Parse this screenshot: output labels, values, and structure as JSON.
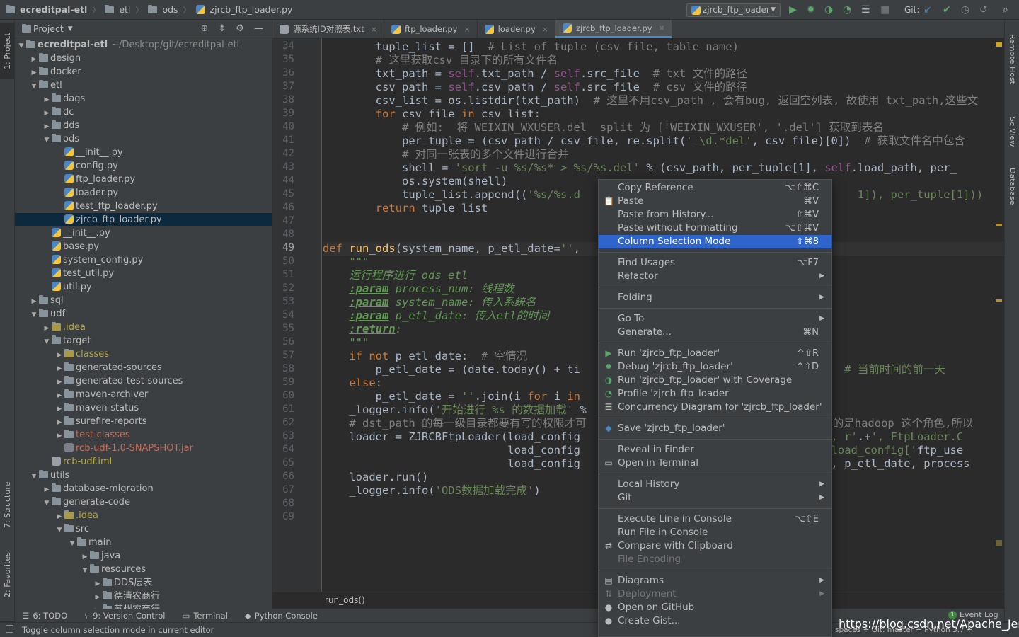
{
  "breadcrumb": [
    "ecreditpal-etl",
    "etl",
    "ods",
    "zjrcb_ftp_loader.py"
  ],
  "run_config": "zjrcb_ftp_loader",
  "git_label": "Git:",
  "project_panel": {
    "title": "Project",
    "root_path": "~/Desktop/git/ecreditpal-etl"
  },
  "tree": [
    {
      "indent": 0,
      "arrow": "open",
      "icon": "folder",
      "label": "ecreditpal-etl",
      "bold": true
    },
    {
      "indent": 1,
      "arrow": "closed",
      "icon": "folder",
      "label": "design"
    },
    {
      "indent": 1,
      "arrow": "closed",
      "icon": "folder",
      "label": "docker"
    },
    {
      "indent": 1,
      "arrow": "open",
      "icon": "folder",
      "label": "etl"
    },
    {
      "indent": 2,
      "arrow": "closed",
      "icon": "folder",
      "label": "dags"
    },
    {
      "indent": 2,
      "arrow": "closed",
      "icon": "folder",
      "label": "dc"
    },
    {
      "indent": 2,
      "arrow": "closed",
      "icon": "folder",
      "label": "dds"
    },
    {
      "indent": 2,
      "arrow": "open",
      "icon": "folder",
      "label": "ods"
    },
    {
      "indent": 3,
      "arrow": "none",
      "icon": "py",
      "label": "__init__.py"
    },
    {
      "indent": 3,
      "arrow": "none",
      "icon": "py",
      "label": "config.py"
    },
    {
      "indent": 3,
      "arrow": "none",
      "icon": "py",
      "label": "ftp_loader.py"
    },
    {
      "indent": 3,
      "arrow": "none",
      "icon": "py",
      "label": "loader.py"
    },
    {
      "indent": 3,
      "arrow": "none",
      "icon": "py",
      "label": "test_ftp_loader.py"
    },
    {
      "indent": 3,
      "arrow": "none",
      "icon": "py",
      "label": "zjrcb_ftp_loader.py",
      "selected": true
    },
    {
      "indent": 2,
      "arrow": "none",
      "icon": "py",
      "label": "__init__.py"
    },
    {
      "indent": 2,
      "arrow": "none",
      "icon": "py",
      "label": "base.py"
    },
    {
      "indent": 2,
      "arrow": "none",
      "icon": "py",
      "label": "system_config.py"
    },
    {
      "indent": 2,
      "arrow": "none",
      "icon": "py",
      "label": "test_util.py"
    },
    {
      "indent": 2,
      "arrow": "none",
      "icon": "py",
      "label": "util.py"
    },
    {
      "indent": 1,
      "arrow": "closed",
      "icon": "folder",
      "label": "sql"
    },
    {
      "indent": 1,
      "arrow": "open",
      "icon": "folder",
      "label": "udf"
    },
    {
      "indent": 2,
      "arrow": "closed",
      "icon": "folder",
      "label": ".idea",
      "color": "yellow"
    },
    {
      "indent": 2,
      "arrow": "open",
      "icon": "folder",
      "label": "target"
    },
    {
      "indent": 3,
      "arrow": "closed",
      "icon": "folder",
      "label": "classes",
      "color": "yellow"
    },
    {
      "indent": 3,
      "arrow": "closed",
      "icon": "folder",
      "label": "generated-sources"
    },
    {
      "indent": 3,
      "arrow": "closed",
      "icon": "folder",
      "label": "generated-test-sources"
    },
    {
      "indent": 3,
      "arrow": "closed",
      "icon": "folder",
      "label": "maven-archiver"
    },
    {
      "indent": 3,
      "arrow": "closed",
      "icon": "folder",
      "label": "maven-status"
    },
    {
      "indent": 3,
      "arrow": "closed",
      "icon": "folder",
      "label": "surefire-reports"
    },
    {
      "indent": 3,
      "arrow": "closed",
      "icon": "folder",
      "label": "test-classes",
      "color": "red"
    },
    {
      "indent": 3,
      "arrow": "none",
      "icon": "jar",
      "label": "rcb-udf-1.0-SNAPSHOT.jar",
      "color": "red"
    },
    {
      "indent": 2,
      "arrow": "none",
      "icon": "iml",
      "label": "rcb-udf.iml",
      "color": "yellow"
    },
    {
      "indent": 1,
      "arrow": "open",
      "icon": "folder",
      "label": "utils"
    },
    {
      "indent": 2,
      "arrow": "closed",
      "icon": "folder",
      "label": "database-migration"
    },
    {
      "indent": 2,
      "arrow": "open",
      "icon": "folder",
      "label": "generate-code"
    },
    {
      "indent": 3,
      "arrow": "closed",
      "icon": "folder",
      "label": ".idea",
      "color": "yellow"
    },
    {
      "indent": 3,
      "arrow": "open",
      "icon": "folder",
      "label": "src"
    },
    {
      "indent": 4,
      "arrow": "open",
      "icon": "folder",
      "label": "main"
    },
    {
      "indent": 5,
      "arrow": "closed",
      "icon": "folder",
      "label": "java"
    },
    {
      "indent": 5,
      "arrow": "open",
      "icon": "folder",
      "label": "resources"
    },
    {
      "indent": 6,
      "arrow": "closed",
      "icon": "folder",
      "label": "DDS层表"
    },
    {
      "indent": 6,
      "arrow": "closed",
      "icon": "folder",
      "label": "德清农商行"
    },
    {
      "indent": 6,
      "arrow": "closed",
      "icon": "folder",
      "label": "苏州农商行"
    }
  ],
  "tabs": [
    {
      "label": "源系统ID对照表.txt",
      "icon": "txt"
    },
    {
      "label": "ftp_loader.py",
      "icon": "py"
    },
    {
      "label": "loader.py",
      "icon": "py"
    },
    {
      "label": "zjrcb_ftp_loader.py",
      "icon": "py",
      "active": true
    }
  ],
  "line_numbers": [
    "34",
    "35",
    "36",
    "37",
    "38",
    "39",
    "40",
    "41",
    "42",
    "43",
    "44",
    "45",
    "46",
    "47",
    "48",
    "49",
    "50",
    "51",
    "52",
    "53",
    "54",
    "55",
    "56",
    "57",
    "58",
    "59",
    "60",
    "61",
    "62",
    "63",
    "64",
    "65",
    "66",
    "67",
    "68",
    "69"
  ],
  "current_line": "49",
  "code_lines": [
    "        tuple_list = []  # List of tuple (csv file, table name)",
    "        # 这里获取csv 目录下的所有文件名",
    "        txt_path = self.txt_path / self.src_file  # txt 文件的路径",
    "        csv_path = self.csv_path / self.src_file  # csv 文件的路径",
    "        csv_list = os.listdir(txt_path)  # 这里不用csv_path , 会有bug, 返回空列表, 故使用 txt_path,这些文",
    "        for csv_file in csv_list:",
    "            # 例如:  将 WEIXIN_WXUSER.del  split 为 ['WEIXIN_WXUSER', '.del'] 获取到表名",
    "            per_tuple = (csv_path / csv_file, re.split('_\\d.*del', csv_file)[0])  # 获取文件名中包含",
    "            # 对同一张表的多个文件进行合并",
    "            shell = 'sort -u %s/%s* > %s/%s.del' % (csv_path, per_tuple[1], self.load_path, per_",
    "            os.system(shell)",
    "            tuple_list.append(('%s/%s.d                                          1]), per_tuple[1]))",
    "        return tuple_list",
    "",
    "",
    "def run_ods(system_name, p_etl_date='',",
    "    \"\"\"",
    "    运行程序进行 ods etl",
    "    :param process_num: 线程数",
    "    :param system_name: 传入系统名",
    "    :param p_etl_date: 传入etl的时间",
    "    :return:",
    "    \"\"\"",
    "    if not p_etl_date:  # 空情况",
    "        p_etl_date = (date.today() + ti                                   d')  # 当前时间的前一天",
    "    else:",
    "        p_etl_date = ''.join(i for i in",
    "    _logger.info('开始进行 %s 的数据加载' %",
    "    # dst_path 的每一级目录都要有写的权限才可                                  使用的是hadoop 这个角色,所以",
    "    loader = ZJRCBFtpLoader(load_config                                  th'], r'.+', FtpLoader.C",
    "                            load_config                                  '], load_config['ftp_use",
    "                            load_config                                  er(), p_etl_date, process",
    "    loader.run()",
    "    _logger.info('ODS数据加载完成')",
    "",
    ""
  ],
  "editor_breadcrumb": "run_ods()",
  "context_menu": [
    {
      "label": "Copy Reference",
      "shortcut": "⌥⇧⌘C"
    },
    {
      "label": "Paste",
      "shortcut": "⌘V",
      "icon": "clipboard-icon"
    },
    {
      "label": "Paste from History...",
      "shortcut": "⇧⌘V"
    },
    {
      "label": "Paste without Formatting",
      "shortcut": "⌥⇧⌘V"
    },
    {
      "label": "Column Selection Mode",
      "shortcut": "⇧⌘8",
      "highlighted": true
    },
    {
      "sep": true
    },
    {
      "label": "Find Usages",
      "shortcut": "⌥F7"
    },
    {
      "label": "Refactor",
      "submenu": true
    },
    {
      "sep": true
    },
    {
      "label": "Folding",
      "submenu": true
    },
    {
      "sep": true
    },
    {
      "label": "Go To",
      "submenu": true
    },
    {
      "label": "Generate...",
      "shortcut": "⌘N"
    },
    {
      "sep": true
    },
    {
      "label": "Run 'zjrcb_ftp_loader'",
      "shortcut": "^⇧R",
      "icon": "run-icon"
    },
    {
      "label": "Debug 'zjrcb_ftp_loader'",
      "shortcut": "^⇧D",
      "icon": "debug-icon"
    },
    {
      "label": "Run 'zjrcb_ftp_loader' with Coverage",
      "icon": "coverage-icon"
    },
    {
      "label": "Profile 'zjrcb_ftp_loader'",
      "icon": "profile-icon"
    },
    {
      "label": "Concurrency Diagram for 'zjrcb_ftp_loader'",
      "icon": "concurrency-icon"
    },
    {
      "sep": true
    },
    {
      "label": "Save 'zjrcb_ftp_loader'",
      "icon": "python-icon"
    },
    {
      "sep": true
    },
    {
      "label": "Reveal in Finder"
    },
    {
      "label": "Open in Terminal",
      "icon": "terminal-icon"
    },
    {
      "sep": true
    },
    {
      "label": "Local History",
      "submenu": true
    },
    {
      "label": "Git",
      "submenu": true
    },
    {
      "sep": true
    },
    {
      "label": "Execute Line in Console",
      "shortcut": "⌥⇧E"
    },
    {
      "label": "Run File in Console"
    },
    {
      "label": "Compare with Clipboard",
      "icon": "compare-icon"
    },
    {
      "label": "File Encoding",
      "disabled": true
    },
    {
      "sep": true
    },
    {
      "label": "Diagrams",
      "submenu": true,
      "icon": "diagram-icon"
    },
    {
      "label": "Deployment",
      "submenu": true,
      "disabled": true,
      "icon": "deployment-icon"
    },
    {
      "label": "Open on GitHub",
      "icon": "github-icon"
    },
    {
      "label": "Create Gist...",
      "icon": "github-icon"
    }
  ],
  "left_tabs": {
    "project": "1: Project",
    "structure": "7: Structure",
    "favorites": "2: Favorites"
  },
  "right_tabs": {
    "remote": "Remote Host",
    "sciview": "SciView",
    "database": "Database"
  },
  "bottom_tabs": [
    "6: TODO",
    "9: Version Control",
    "Terminal",
    "Python Console"
  ],
  "event_log": {
    "count": "1",
    "label": "Event Log"
  },
  "status_text": "Toggle column selection mode in current editor",
  "status_right": "spaces ÷   Git: master ÷   Python 3.7 ÷",
  "watermark": "https://blog.csdn.net/Apache_Jerry",
  "colors": {
    "accent": "#2f65ca",
    "keyword": "#cc7832",
    "string": "#6a8759",
    "comment": "#808080",
    "self": "#94558d",
    "function": "#ffc66d",
    "selection": "#0d293e"
  }
}
